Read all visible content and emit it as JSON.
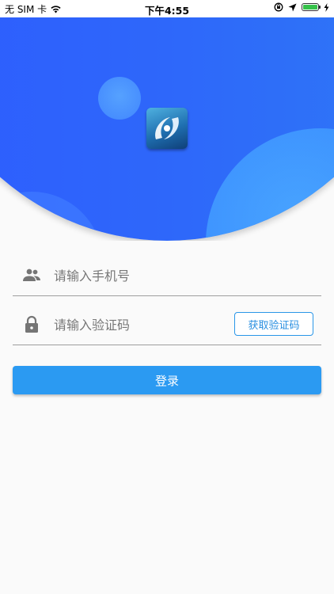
{
  "status_bar": {
    "carrier": "无 SIM 卡",
    "time": "下午4:55",
    "battery_color": "#36c24a",
    "icons": [
      "wifi-icon",
      "orientation-lock-icon",
      "location-icon",
      "battery-icon",
      "charging-icon"
    ]
  },
  "header": {
    "gradient_start": "#2d5cff",
    "gradient_end": "#2f78f6",
    "logo_icon": "app-logo-icon"
  },
  "phone_field": {
    "icon": "people-icon",
    "placeholder": "请输入手机号"
  },
  "code_field": {
    "icon": "lock-icon",
    "placeholder": "请输入验证码",
    "get_code_label": "获取验证码"
  },
  "login_button": {
    "label": "登录",
    "color": "#2b9af2"
  }
}
